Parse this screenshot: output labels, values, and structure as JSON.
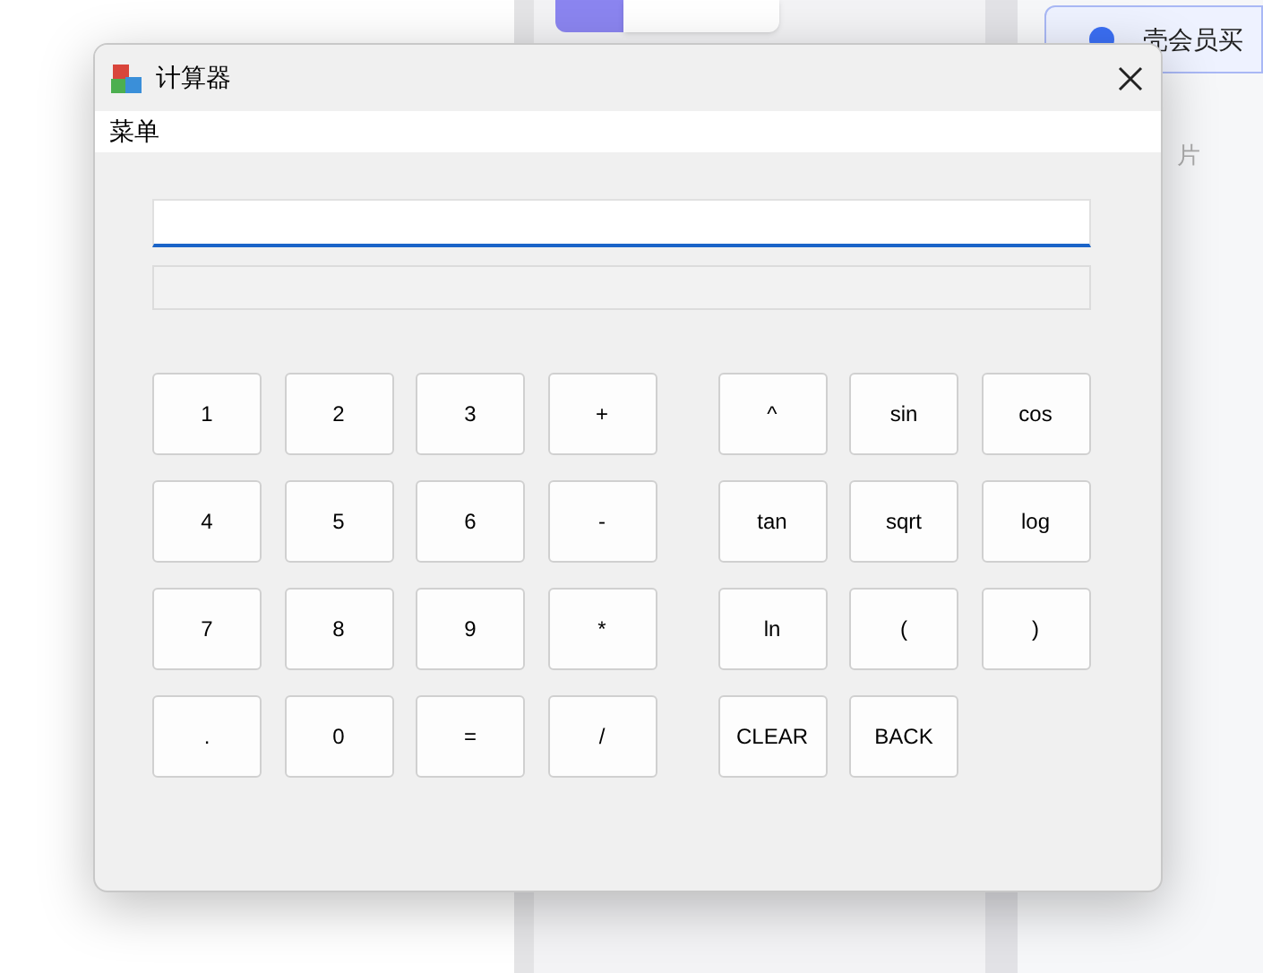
{
  "background": {
    "card_text": "壳会员买",
    "side_text": "片"
  },
  "window": {
    "title": "计算器"
  },
  "menu": [
    "菜单"
  ],
  "keypad": [
    [
      "1",
      "2",
      "3",
      "+"
    ],
    [
      "4",
      "5",
      "6",
      "-"
    ],
    [
      "7",
      "8",
      "9",
      "*"
    ],
    [
      ".",
      "0",
      "=",
      "/"
    ]
  ],
  "functions": [
    [
      "^",
      "sin",
      "cos"
    ],
    [
      "tan",
      "sqrt",
      "log"
    ],
    [
      "ln",
      "(",
      ")"
    ],
    [
      "CLEAR",
      "BACK"
    ]
  ]
}
